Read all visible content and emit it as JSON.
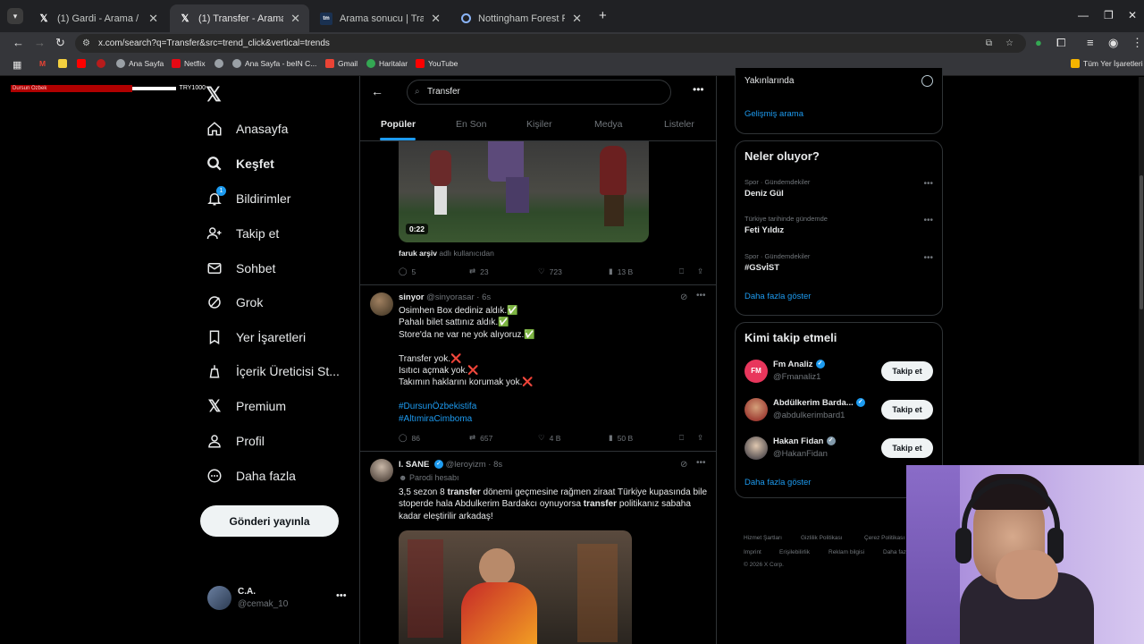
{
  "browser": {
    "tabs": [
      {
        "title": "(1) Gardi - Arama / X",
        "favicon": "x-icon",
        "active": false
      },
      {
        "title": "(1) Transfer - Arama / X",
        "favicon": "x-icon",
        "active": true
      },
      {
        "title": "Arama sonucu | Transfermarkt",
        "favicon": "tm-icon",
        "active": false
      },
      {
        "title": "Nottingham Forest FC - Google",
        "favicon": "google-icon",
        "active": false
      }
    ],
    "url": "x.com/search?q=Transfer&src=trend_click&vertical=trends",
    "bookmarks": [
      "Ana Sayfa",
      "Netflix",
      "Ana Sayfa - beIN C...",
      "Gmail",
      "Haritalar",
      "YouTube"
    ],
    "all_bookmarks": "Tüm Yer İşaretleri"
  },
  "overlay_banner": {
    "left": "Dursun Özbek",
    "right": "TRY1000"
  },
  "sidebar": {
    "items": [
      {
        "label": "Anasayfa",
        "icon": "home-icon"
      },
      {
        "label": "Keşfet",
        "icon": "search-icon"
      },
      {
        "label": "Bildirimler",
        "icon": "bell-icon",
        "badge": "1"
      },
      {
        "label": "Takip et",
        "icon": "follow-icon"
      },
      {
        "label": "Sohbet",
        "icon": "mail-icon"
      },
      {
        "label": "Grok",
        "icon": "grok-icon"
      },
      {
        "label": "Yer İşaretleri",
        "icon": "bookmark-icon"
      },
      {
        "label": "İçerik Üreticisi St...",
        "icon": "creator-icon"
      },
      {
        "label": "Premium",
        "icon": "x-icon"
      },
      {
        "label": "Profil",
        "icon": "profile-icon"
      },
      {
        "label": "Daha fazla",
        "icon": "more-icon"
      }
    ],
    "post_button": "Gönderi yayınla",
    "account": {
      "name": "C.A.",
      "handle": "@cemak_10"
    }
  },
  "search": {
    "query": "Transfer",
    "tabs": [
      "Popüler",
      "En Son",
      "Kişiler",
      "Medya",
      "Listeler"
    ],
    "active_tab": "Popüler"
  },
  "tweets": [
    {
      "video_duration": "0:22",
      "reply_to_user": "faruk arşiv",
      "reply_suffix": "adlı kullanıcıdan",
      "stats": {
        "replies": "5",
        "retweets": "23",
        "likes": "723",
        "views": "13 B"
      }
    },
    {
      "name": "sinyor",
      "handle": "@sinyorasar",
      "time": "6s",
      "lines": [
        "Osimhen Box dediniz aldık.✅",
        "Pahalı bilet sattınız aldık.✅",
        "Store'da ne var ne yok alıyoruz.✅",
        "",
        "Transfer yok.❌",
        "Isıtıcı açmak yok.❌",
        "Takımın haklarını korumak yok.❌"
      ],
      "hashtags": [
        "#DursunÖzbekistifa",
        "#AltımiraCimboma"
      ],
      "stats": {
        "replies": "86",
        "retweets": "657",
        "likes": "4 B",
        "views": "50 B"
      }
    },
    {
      "name": "I. SANE",
      "handle": "@leroyizm",
      "time": "8s",
      "parody_label": "Parodi hesabı",
      "text_parts": [
        "3,5 sezon 8 ",
        "transfer",
        " dönemi geçmesine rağmen ziraat Türkiye kupasında bile stoperde hala Abdulkerim Bardakcı oynuyorsa ",
        "transfer",
        " politikanız sabaha kadar eleştirilir arkadaş!"
      ]
    }
  ],
  "right": {
    "location_option": "Yakınlarında",
    "advanced_search": "Gelişmiş arama",
    "trends_title": "Neler oluyor?",
    "trends": [
      {
        "meta": "Spor · Gündemdekiler",
        "title": "Deniz Gül"
      },
      {
        "meta": "Türkiye tarihinde gündemde",
        "title": "Feti Yıldız"
      },
      {
        "meta": "Spor · Gündemdekiler",
        "title": "#GSvİST"
      }
    ],
    "show_more": "Daha fazla göster",
    "follow_title": "Kimi takip etmeli",
    "suggestions": [
      {
        "name": "Fm Analiz",
        "handle": "@Fmanaliz1",
        "button": "Takip et"
      },
      {
        "name": "Abdülkerim Barda...",
        "handle": "@abdulkerimbard1",
        "button": "Takip et"
      },
      {
        "name": "Hakan Fidan",
        "handle": "@HakanFidan",
        "button": "Takip et"
      }
    ],
    "follow_more": "Daha fazla göster",
    "footer": [
      "Hizmet Şartları",
      "Gizlilik Politikası",
      "Çerez Politikası",
      "Imprint",
      "Erişilebilirlik",
      "Reklam bilgisi",
      "Daha fazla"
    ],
    "copyright": "© 2026 X Corp."
  },
  "colors": {
    "accent": "#1d9bf0",
    "bg": "#000000",
    "border": "#2f3336",
    "muted": "#71767b"
  }
}
